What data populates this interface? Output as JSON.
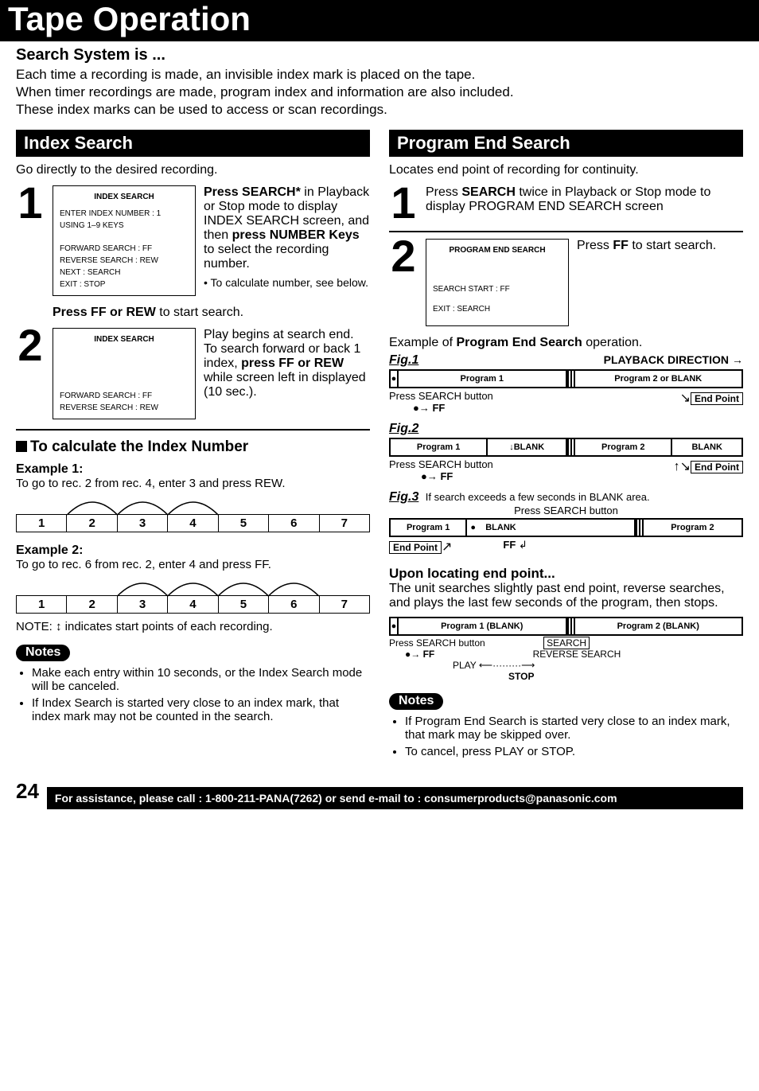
{
  "main_title": "Tape Operation",
  "search_heading": "Search System is ...",
  "intro_para": "Each time a recording is made, an invisible index mark is placed on the tape.\nWhen timer recordings are made, program index and information are also included.\nThese index marks can be used to access or scan recordings.",
  "left": {
    "section_title": "Index Search",
    "sub_intro": "Go directly to the desired recording.",
    "step1": {
      "num": "1",
      "osd": {
        "title": "INDEX SEARCH",
        "lines": [
          "ENTER INDEX NUMBER : 1",
          "USING 1–9 KEYS",
          "",
          "FORWARD SEARCH : FF",
          "REVERSE SEARCH : REW",
          "NEXT : SEARCH",
          "EXIT : STOP"
        ]
      },
      "text_pre": "Press ",
      "text_bold1": "SEARCH*",
      "text_mid1": " in Playback or Stop mode to display INDEX SEARCH screen, and then ",
      "text_bold2": "press NUMBER Keys",
      "text_mid2": " to select the recording number.",
      "fineprint": "• To calculate number, see below.",
      "extra": "Press FF or REW",
      "extra_tail": " to start search."
    },
    "step2": {
      "num": "2",
      "osd": {
        "title": "INDEX SEARCH",
        "lines": [
          "",
          "",
          "",
          "FORWARD SEARCH : FF",
          "REVERSE SEARCH : REW"
        ]
      },
      "text": "Play begins at search end. To search forward or back 1 index, ",
      "text_bold": "press FF or REW",
      "text_tail": " while screen left in displayed (10 sec.)."
    },
    "calc_head": "To calculate the Index Number",
    "example1": {
      "head": "Example 1:",
      "text": "To go to rec. 2 from rec. 4, enter 3 and press REW."
    },
    "example2": {
      "head": "Example 2:",
      "text": "To go to rec. 6 from rec. 2, enter 4 and press FF."
    },
    "numbers": [
      "1",
      "2",
      "3",
      "4",
      "5",
      "6",
      "7"
    ],
    "note_line": "NOTE: ↕ indicates start points of each recording.",
    "notes_label": "Notes",
    "notes": [
      "Make each entry within 10 seconds, or the Index Search mode will be canceled.",
      "If Index Search is started very close to an index mark, that index mark may not be counted in the search."
    ]
  },
  "right": {
    "section_title": "Program End Search",
    "sub_intro": "Locates end point of recording for continuity.",
    "step1": {
      "num": "1",
      "text_pre": "Press ",
      "text_bold1": "SEARCH",
      "text_mid": " twice in Playback or Stop mode to display PROGRAM END SEARCH screen"
    },
    "step2": {
      "num": "2",
      "osd": {
        "title": "PROGRAM END SEARCH",
        "lines": [
          "",
          "",
          "SEARCH START : FF",
          "",
          "EXIT : SEARCH"
        ]
      },
      "text_pre": "Press ",
      "text_bold": "FF",
      "text_tail": " to start search."
    },
    "example_head": "Example of Program End Search operation.",
    "playback_dir": "PLAYBACK DIRECTION",
    "fig1": {
      "label": "Fig.1",
      "segA": "Program 1",
      "segB": "Program 2 or BLANK",
      "caption_left": "Press SEARCH button",
      "caption_ff": "FF",
      "endpoint": "End Point"
    },
    "fig2": {
      "label": "Fig.2",
      "segs": [
        "Program 1",
        "↓BLANK",
        "Program 2",
        "BLANK"
      ],
      "caption_left": "Press SEARCH button",
      "caption_ff": "FF",
      "endpoint": "End Point"
    },
    "fig3": {
      "label": "Fig.3",
      "sub": "If search exceeds a few seconds in BLANK area.",
      "press": "Press SEARCH button",
      "segs": [
        "Program 1",
        "BLANK",
        "Program 2"
      ],
      "ff": "FF",
      "endpoint": "End Point"
    },
    "upon_head": "Upon locating end point...",
    "upon_text": "The unit searches slightly past end point, reverse searches, and plays the last few seconds of the program, then stops.",
    "upon_fig": {
      "segs": [
        "Program 1 (BLANK)",
        "Program 2 (BLANK)"
      ],
      "press": "Press SEARCH button",
      "ff": "FF",
      "search": "SEARCH",
      "play": "PLAY",
      "reverse": "REVERSE SEARCH",
      "stop": "STOP"
    },
    "notes_label": "Notes",
    "notes": [
      "If Program End Search is started very close to an index mark, that mark may be skipped over.",
      "To cancel, press PLAY or STOP."
    ]
  },
  "footer": {
    "page_num": "24",
    "text": "For assistance, please call : 1-800-211-PANA(7262) or send e-mail to : consumerproducts@panasonic.com"
  }
}
